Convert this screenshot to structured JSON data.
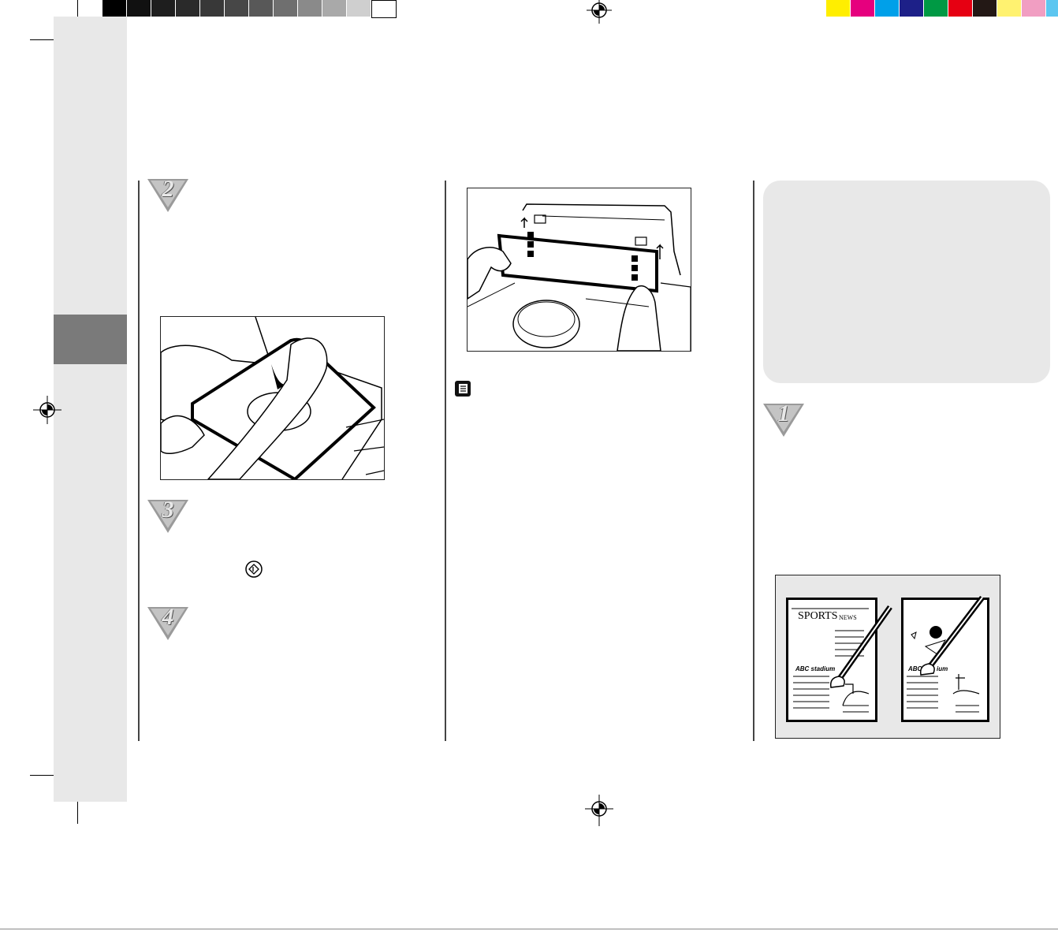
{
  "colors": {
    "grayscale_bar": [
      "#000000",
      "#111111",
      "#1e1e1e",
      "#2a2a2a",
      "#383838",
      "#474747",
      "#585858",
      "#6f6f6f",
      "#8a8a8a",
      "#a9a9a9",
      "#cfcfcf",
      "#ffffff"
    ],
    "process_bar": [
      "#ffee00",
      "#e6007e",
      "#00a0e9",
      "#1d2088",
      "#009944",
      "#e60012",
      "#231815",
      "#fff270",
      "#f19ec2",
      "#5cc6f0"
    ],
    "sidebar": "#e8e8e8",
    "sidebar_tab": "#7a7a7a"
  },
  "steps": [
    {
      "number": "2"
    },
    {
      "number": "3"
    },
    {
      "number": "4"
    },
    {
      "number": "1"
    }
  ],
  "figure_newspaper": {
    "headline": "SPORTS",
    "masthead": "NEWS",
    "caption_left": "ABC  stadium",
    "caption_right_a": "ABC",
    "caption_right_b": "ium"
  },
  "icons": {
    "start_button": "start-button-icon",
    "note": "note-icon",
    "registration": "registration-mark-icon"
  }
}
